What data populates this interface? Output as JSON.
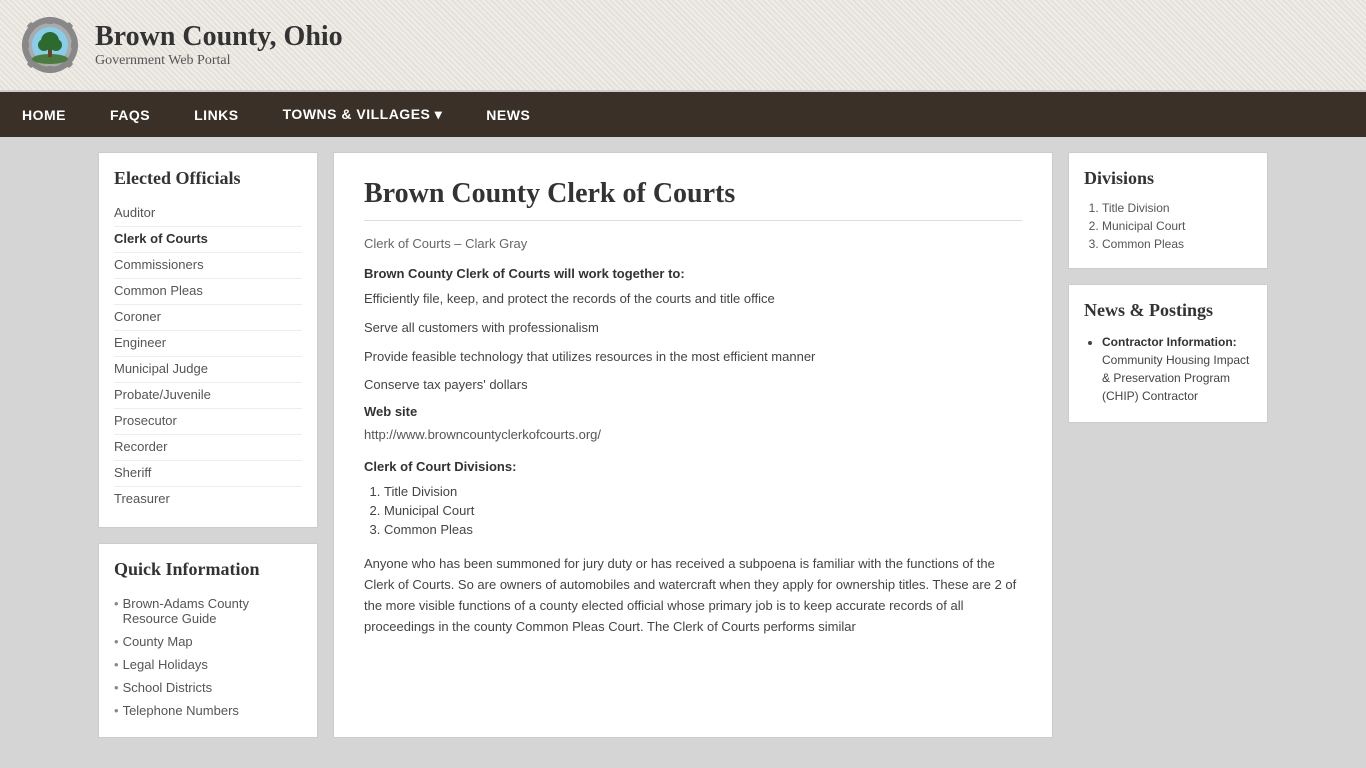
{
  "header": {
    "title": "Brown County, Ohio",
    "subtitle": "Government Web Portal",
    "logo_alt": "Brown County seal with tree"
  },
  "nav": {
    "items": [
      {
        "label": "HOME",
        "active": false
      },
      {
        "label": "FAQS",
        "active": false
      },
      {
        "label": "LINKS",
        "active": false
      },
      {
        "label": "TOWNS & VILLAGES",
        "active": false,
        "has_dropdown": true
      },
      {
        "label": "NEWS",
        "active": false
      }
    ]
  },
  "left_sidebar": {
    "elected_officials": {
      "heading": "Elected Officials",
      "items": [
        {
          "label": "Auditor",
          "active": false
        },
        {
          "label": "Clerk of Courts",
          "active": true
        },
        {
          "label": "Commissioners",
          "active": false
        },
        {
          "label": "Common Pleas",
          "active": false
        },
        {
          "label": "Coroner",
          "active": false
        },
        {
          "label": "Engineer",
          "active": false
        },
        {
          "label": "Municipal Judge",
          "active": false
        },
        {
          "label": "Probate/Juvenile",
          "active": false
        },
        {
          "label": "Prosecutor",
          "active": false
        },
        {
          "label": "Recorder",
          "active": false
        },
        {
          "label": "Sheriff",
          "active": false
        },
        {
          "label": "Treasurer",
          "active": false
        }
      ]
    },
    "quick_info": {
      "heading": "Quick Information",
      "items": [
        {
          "label": "Brown-Adams County Resource Guide"
        },
        {
          "label": "County Map"
        },
        {
          "label": "Legal Holidays"
        },
        {
          "label": "School Districts"
        },
        {
          "label": "Telephone Numbers"
        }
      ]
    }
  },
  "center": {
    "page_title": "Brown County Clerk of Courts",
    "clerk_subtitle": "Clerk of Courts – Clark Gray",
    "mission_title": "Brown County Clerk of Courts will work together to:",
    "mission_items": [
      "Efficiently file, keep, and protect the records of the courts and title office",
      "Serve all customers with professionalism",
      "Provide feasible technology that utilizes resources in the most efficient manner",
      "Conserve tax payers' dollars"
    ],
    "website_label": "Web site",
    "website_url": "http://www.browncountyclerkofcourts.org/",
    "divisions_title": "Clerk of Court Divisions:",
    "divisions": [
      "Title Division",
      "Municipal Court",
      "Common Pleas"
    ],
    "body_text": "Anyone who has been summoned for jury duty or has received a subpoena is familiar with the functions of the Clerk of Courts. So are owners of automobiles and watercraft when they apply for ownership titles. These are 2 of the more visible functions of a county elected official whose primary job is to keep accurate records of all proceedings in the county Common Pleas Court. The Clerk of Courts performs similar"
  },
  "right_sidebar": {
    "divisions": {
      "heading": "Divisions",
      "items": [
        "Title Division",
        "Municipal Court",
        "Common Pleas"
      ]
    },
    "news": {
      "heading": "News & Postings",
      "items": [
        {
          "label": "Contractor Information:",
          "body": "Community Housing Impact & Preservation Program (CHIP) Contractor"
        }
      ]
    }
  }
}
